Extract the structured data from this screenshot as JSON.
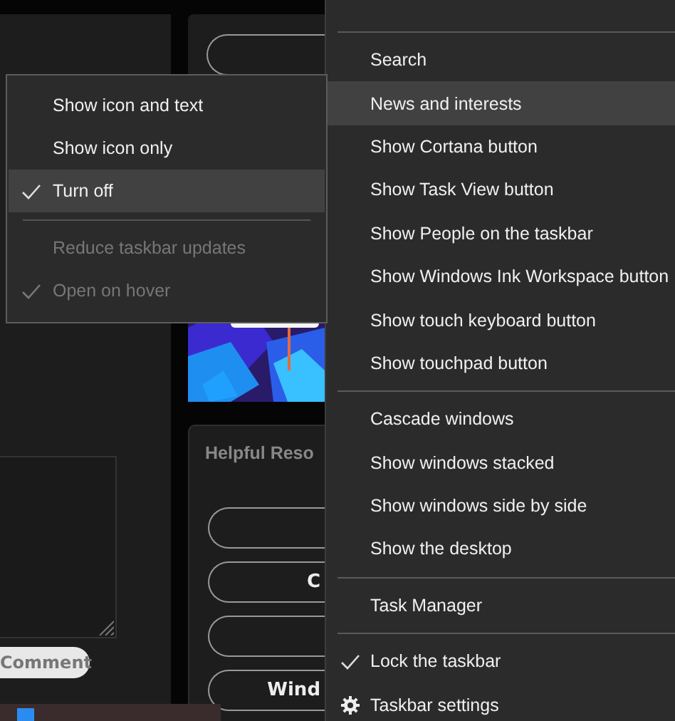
{
  "page": {
    "comment_button": "Comment",
    "resources": {
      "title": "Helpful Reso",
      "buttons": [
        {
          "kind": "blank"
        },
        {
          "kind": "labeled",
          "label": "C"
        },
        {
          "kind": "blank"
        },
        {
          "kind": "labeled",
          "label": "Wind"
        }
      ]
    }
  },
  "context_menu": {
    "items": [
      {
        "kind": "separator"
      },
      {
        "kind": "item",
        "label": "Search",
        "selected": false,
        "checked": false
      },
      {
        "kind": "item",
        "label": "News and interests",
        "selected": true,
        "checked": false
      },
      {
        "kind": "item",
        "label": "Show Cortana button",
        "selected": false,
        "checked": false
      },
      {
        "kind": "item",
        "label": "Show Task View button",
        "selected": false,
        "checked": false
      },
      {
        "kind": "item",
        "label": "Show People on the taskbar",
        "selected": false,
        "checked": false
      },
      {
        "kind": "item",
        "label": "Show Windows Ink Workspace button",
        "selected": false,
        "checked": false
      },
      {
        "kind": "item",
        "label": "Show touch keyboard button",
        "selected": false,
        "checked": false
      },
      {
        "kind": "item",
        "label": "Show touchpad button",
        "selected": false,
        "checked": false
      },
      {
        "kind": "separator"
      },
      {
        "kind": "item",
        "label": "Cascade windows",
        "selected": false,
        "checked": false
      },
      {
        "kind": "item",
        "label": "Show windows stacked",
        "selected": false,
        "checked": false
      },
      {
        "kind": "item",
        "label": "Show windows side by side",
        "selected": false,
        "checked": false
      },
      {
        "kind": "item",
        "label": "Show the desktop",
        "selected": false,
        "checked": false
      },
      {
        "kind": "separator"
      },
      {
        "kind": "item",
        "label": "Task Manager",
        "selected": false,
        "checked": false
      },
      {
        "kind": "separator"
      },
      {
        "kind": "item",
        "label": "Lock the taskbar",
        "selected": false,
        "checked": true
      },
      {
        "kind": "gear-item",
        "label": "Taskbar settings",
        "selected": false,
        "checked": false
      }
    ]
  },
  "submenu": {
    "items": [
      {
        "kind": "item",
        "label": "Show icon and text",
        "selected": false,
        "checked": false,
        "disabled": false
      },
      {
        "kind": "item",
        "label": "Show icon only",
        "selected": false,
        "checked": false,
        "disabled": false
      },
      {
        "kind": "item",
        "label": "Turn off",
        "selected": true,
        "checked": true,
        "disabled": false
      },
      {
        "kind": "separator"
      },
      {
        "kind": "item",
        "label": "Reduce taskbar updates",
        "selected": false,
        "checked": false,
        "disabled": true
      },
      {
        "kind": "item",
        "label": "Open on hover",
        "selected": false,
        "checked": true,
        "disabled": true
      }
    ]
  }
}
